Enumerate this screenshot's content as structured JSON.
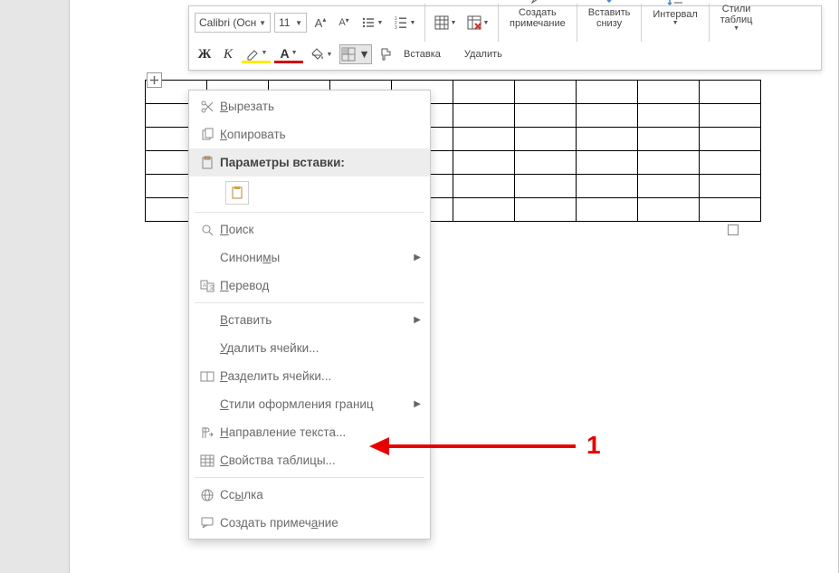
{
  "toolbar": {
    "font_name": "Calibri (Осн",
    "font_size": "11",
    "insert_label": "Вставка",
    "delete_label": "Удалить",
    "comment_label_l1": "Создать",
    "comment_label_l2": "примечание",
    "insert_below_l1": "Вставить",
    "insert_below_l2": "снизу",
    "interval_label": "Интервал",
    "styles_label_l1": "Стили",
    "styles_label_l2": "таблиц",
    "bold_letter": "Ж",
    "italic_letter": "К"
  },
  "context_menu": {
    "cut": "Вырезать",
    "copy": "Копировать",
    "paste_header": "Параметры вставки:",
    "search": "Поиск",
    "synonyms": "Синонимы",
    "translate": "Перевод",
    "insert": "Вставить",
    "delete_cells": "Удалить ячейки...",
    "split_cells": "Разделить ячейки...",
    "border_styles": "Стили оформления границ",
    "text_direction": "Направление текста...",
    "table_props": "Свойства таблицы...",
    "link": "Ссылка",
    "new_comment": "Создать примечание"
  },
  "annotation": {
    "number": "1"
  },
  "table": {
    "rows": 6,
    "cols": 10
  }
}
